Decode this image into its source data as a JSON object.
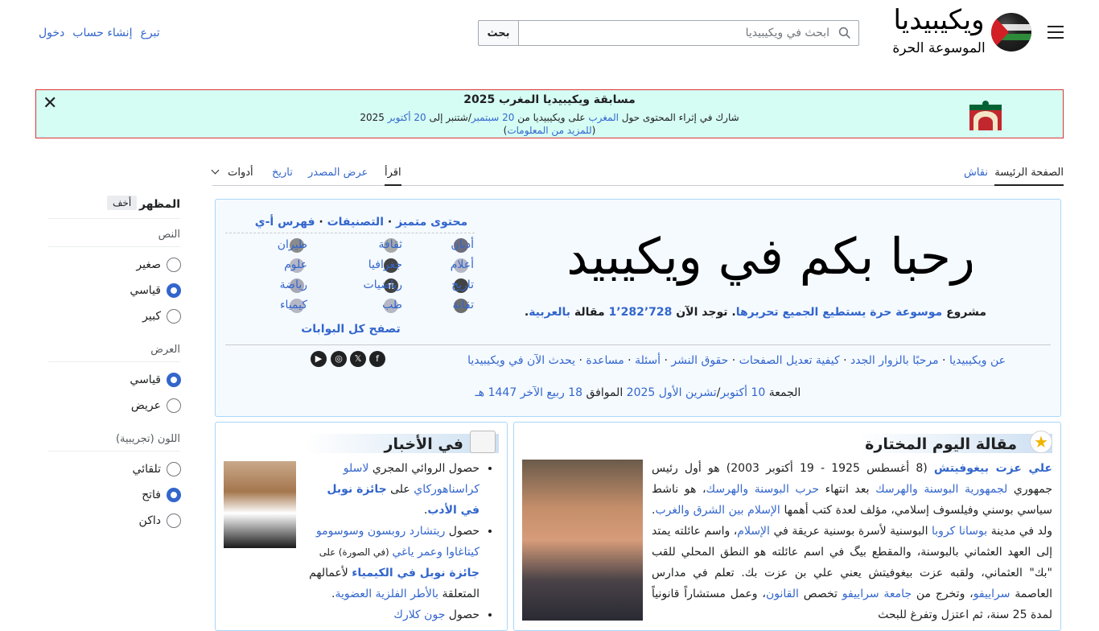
{
  "header": {
    "logo_word": "ويكيبيديا",
    "logo_tagline": "الموسوعة الحرة",
    "search_placeholder": "ابحث في ويكيبيديا",
    "search_button": "بحث",
    "user_links": [
      "تبرع",
      "إنشاء حساب",
      "دخول"
    ]
  },
  "banner": {
    "title": "مسابقة ويكيبيديا المغرب 2025",
    "line1_before": "شارك في إثراء المحتوى حول ",
    "line1_link1": "المغرب",
    "line1_mid": " على ويكيبيديا من ",
    "line1_link2": "20 سبتمبر",
    "line1_mid2": "/شتنبر إلى ",
    "line1_link3": "20 أكتوبر",
    "line1_after": " 2025",
    "line2_link": "للمزيد من المعلومات",
    "close": "✕"
  },
  "tabs": {
    "main_page": "الصفحة الرئيسة",
    "talk": "نقاش",
    "read": "اقرأ",
    "view_source": "عرض المصدر",
    "history": "تاريخ",
    "tools": "أدوات"
  },
  "appearance": {
    "title": "المظهر",
    "hide": "أخف",
    "text_label": "النص",
    "text_options": [
      "صغير",
      "قياسي",
      "كبير"
    ],
    "text_selected": 1,
    "width_label": "العرض",
    "width_options": [
      "قياسي",
      "عريض"
    ],
    "width_selected": 0,
    "color_label": "اللون (تجريبية)",
    "color_options": [
      "تلقائي",
      "فاتح",
      "داكن"
    ],
    "color_selected": 1
  },
  "welcome": {
    "calligraphy": "مرحبا بكم في ويكيبيديا",
    "desc_prefix": "مشروع ",
    "desc_link": "موسوعة حرة يستطيع الجميع تحريرها",
    "desc_mid": ". توجد الآن ",
    "desc_count": "1٬282٬728",
    "desc_suffix": " مقالة ",
    "desc_lang": "بالعربية",
    "portals_head": [
      "محتوى متميز",
      "التصنيفات",
      "فهرس أ-ي"
    ],
    "portals": [
      [
        "أديان",
        "ثقافة",
        "طيران"
      ],
      [
        "أعلام",
        "جغرافيا",
        "علوم"
      ],
      [
        "تاريخ",
        "رياضيات",
        "رياضة"
      ],
      [
        "تقانة",
        "طب",
        "كيمياء"
      ]
    ],
    "all_portals": "تصفح كل البوابات",
    "links": [
      "عن ويكيبيديا",
      "مرحبًا بالزوار الجدد",
      "كيفية تعديل الصفحات",
      "حقوق النشر",
      "أسئلة",
      "مساعدة",
      "يحدث الآن في ويكيبيديا"
    ],
    "date_prefix": "الجمعة ",
    "date_link1": "10 أكتوبر",
    "date_mid1": "/",
    "date_link2": "تشرين الأول 2025",
    "date_mid2": " الموافق ",
    "date_link3": "18 ربيع الآخر 1447 هـ",
    "social": [
      "f",
      "𝕏",
      "◎",
      "▶"
    ]
  },
  "featured": {
    "title": "مقالة اليوم المختارة",
    "name": "علي عزت بيغوفيتش",
    "text1": " (8 أغسطس 1925 - 19 أكتوبر 2003) هو أول رئيس جمهوري ",
    "link1": "لجمهورية البوسنة والهرسك",
    "text2": " بعد انتهاء ",
    "link2": "حرب البوسنة والهرسك",
    "text3": "، هو ناشط سياسي بوسني وفيلسوف إسلامي، مؤلف لعدة كتب أهمها ",
    "link3": "الإسلام بين الشرق والغرب",
    "text4": ". ولد في مدينة ",
    "link4": "بوسانا كروبا",
    "text5": " البوسنية لأسرة بوسنية عريقة في ",
    "link5": "الإسلام",
    "text6": "، واسم عائلته يمتد إلى العهد العثماني بالبوسنة، والمقطع بيگ في اسم عائلته هو النطق المحلي للقب \"بك\" العثماني، ولقبه عزت بيغوفيتش يعني علي بن عزت بك. تعلم في مدارس العاصمة ",
    "link6": "سراييفو",
    "text7": "، وتخرج من ",
    "link7": "جامعة سراييفو",
    "text8": " تخصص ",
    "link8": "القانون",
    "text9": "، وعمل مستشاراً قانونياً لمدة 25 سنة، ثم اعتزل وتفرغ للبحث"
  },
  "news": {
    "title": "في الأخبار",
    "i1_a": "حصول الروائي المجري ",
    "i1_link1": "لاسلو كراسناهوركاي",
    "i1_b": " على ",
    "i1_link2": "جائزة نوبل في الأدب",
    "i1_c": ".",
    "i2_a": "حصول ",
    "i2_link1": "ريتشارد روبسون",
    "i2_b": " ",
    "i2_link2": "وسوسومو كيتاغاوا",
    "i2_c": " ",
    "i2_link3": "وعمر ياغي",
    "i2_d": " (في الصورة) على ",
    "i2_link4": "جائزة نوبل في الكيمياء",
    "i2_e": " لأعمالهم المتعلقة ",
    "i2_link5": "بالأطر الفلزية العضوية",
    "i2_f": ".",
    "i3_a": "حصول ",
    "i3_link1": "جون كلارك"
  },
  "colors": {
    "link": "#3366cc",
    "banner_bg": "#d5fdf4",
    "banner_border": "#dd3333",
    "box_border": "#a7d7f9"
  }
}
